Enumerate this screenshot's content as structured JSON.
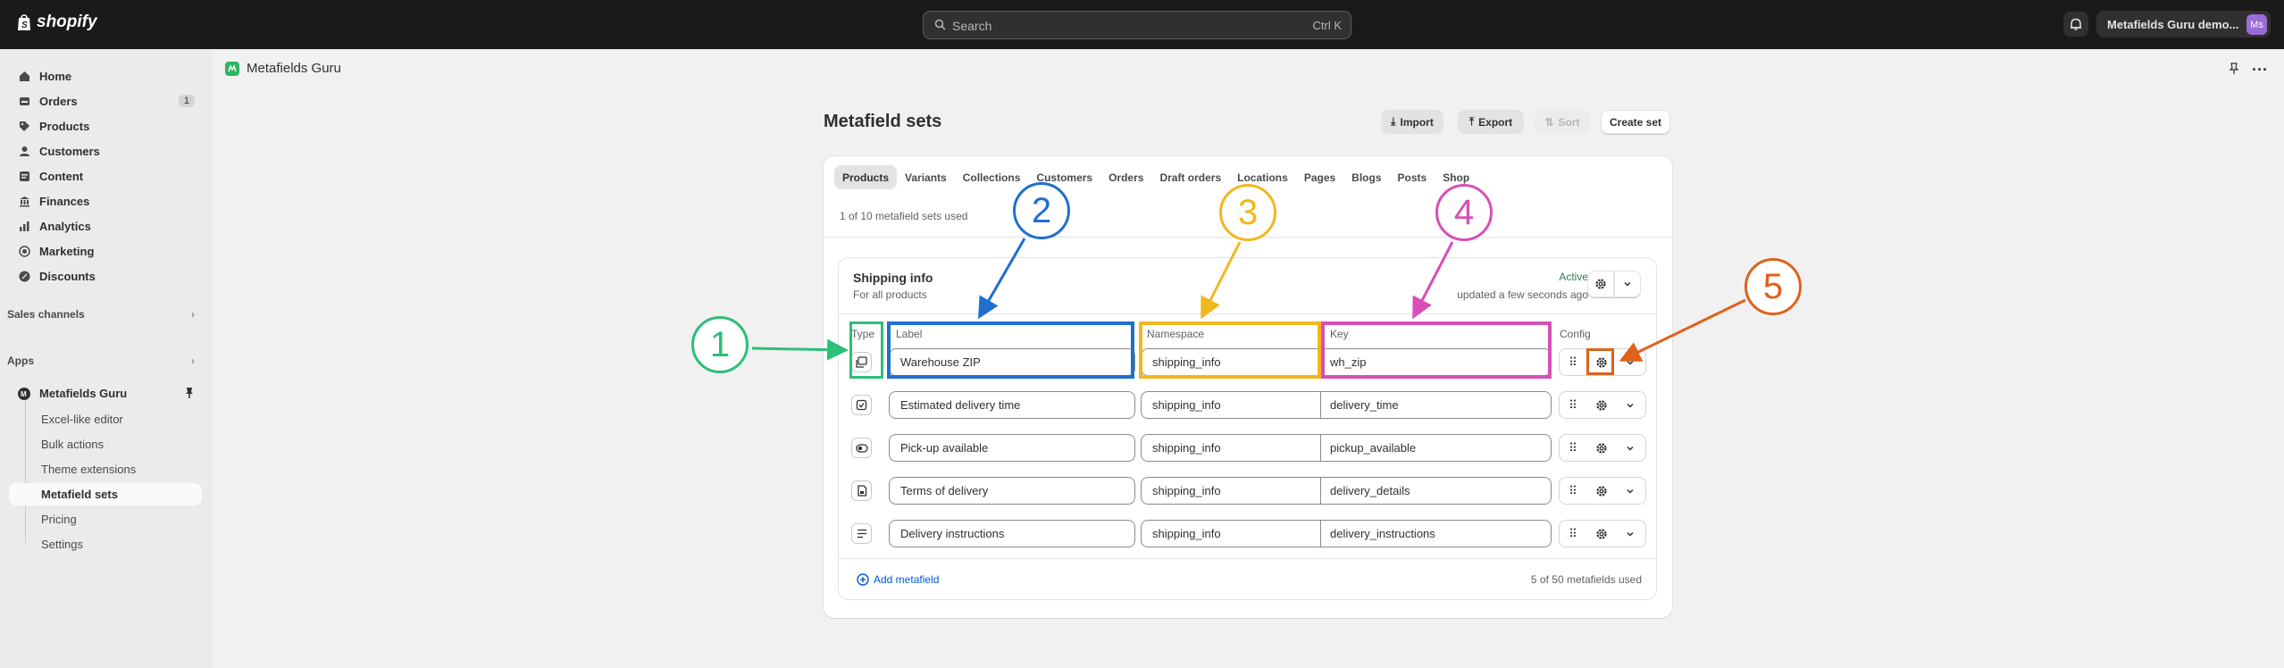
{
  "topbar": {
    "brand": "shopify",
    "search_placeholder": "Search",
    "search_shortcut": "Ctrl K",
    "store_name": "Metafields Guru demo...",
    "avatar_initials": "Ms"
  },
  "sidebar": {
    "items": [
      {
        "label": "Home",
        "icon": "home-icon"
      },
      {
        "label": "Orders",
        "icon": "orders-icon",
        "count": "1"
      },
      {
        "label": "Products",
        "icon": "tag-icon"
      },
      {
        "label": "Customers",
        "icon": "person-icon"
      },
      {
        "label": "Content",
        "icon": "content-icon"
      },
      {
        "label": "Finances",
        "icon": "bank-icon"
      },
      {
        "label": "Analytics",
        "icon": "chart-icon"
      },
      {
        "label": "Marketing",
        "icon": "target-icon"
      },
      {
        "label": "Discounts",
        "icon": "discount-icon"
      }
    ],
    "sales_channels": "Sales channels",
    "apps": "Apps",
    "app_name": "Metafields Guru",
    "app_sub": [
      "Excel-like editor",
      "Bulk actions",
      "Theme extensions",
      "Metafield sets",
      "Pricing",
      "Settings"
    ]
  },
  "page": {
    "app_title": "Metafields Guru",
    "title": "Metafield sets",
    "import": "Import",
    "export": "Export",
    "sort": "Sort",
    "create": "Create set"
  },
  "tabs": [
    "Products",
    "Variants",
    "Collections",
    "Customers",
    "Orders",
    "Draft orders",
    "Locations",
    "Pages",
    "Blogs",
    "Posts",
    "Shop"
  ],
  "usage": "1 of 10 metafield sets used",
  "set": {
    "title": "Shipping info",
    "subtitle": "For all products",
    "status": "Active",
    "updated": "updated a few seconds ago",
    "headers": {
      "type": "Type",
      "label": "Label",
      "namespace": "Namespace",
      "key": "Key",
      "config": "Config"
    },
    "rows": [
      {
        "label": "Warehouse ZIP",
        "namespace": "shipping_info",
        "key": "wh_zip",
        "type_icon": "text-type-icon"
      },
      {
        "label": "Estimated delivery time",
        "namespace": "shipping_info",
        "key": "delivery_time",
        "type_icon": "checkbox-type-icon"
      },
      {
        "label": "Pick-up available",
        "namespace": "shipping_info",
        "key": "pickup_available",
        "type_icon": "toggle-type-icon"
      },
      {
        "label": "Terms of delivery",
        "namespace": "shipping_info",
        "key": "delivery_details",
        "type_icon": "file-type-icon"
      },
      {
        "label": "Delivery instructions",
        "namespace": "shipping_info",
        "key": "delivery_instructions",
        "type_icon": "multiline-type-icon"
      }
    ],
    "add": "Add metafield",
    "used": "5 of 50 metafields used"
  },
  "annotations": {
    "labels": [
      "1",
      "2",
      "3",
      "4",
      "5"
    ],
    "colors": [
      "#2cbf78",
      "#1e6fd0",
      "#f2b71f",
      "#d84fb8",
      "#e0611a"
    ]
  }
}
